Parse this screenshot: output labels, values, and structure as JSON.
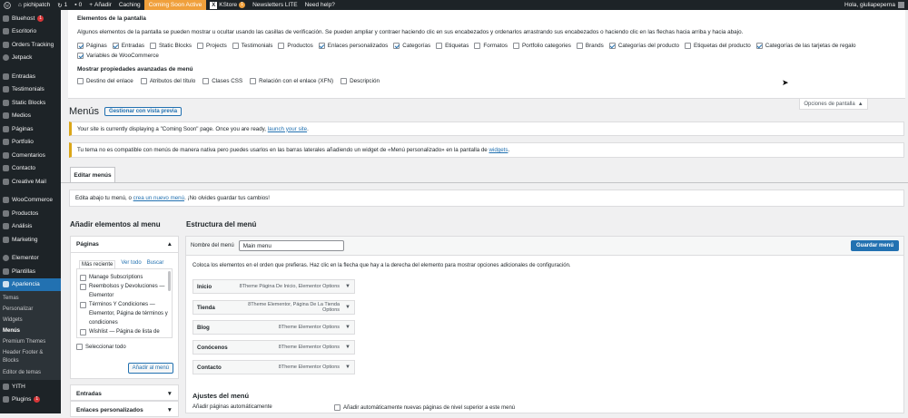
{
  "adminbar": {
    "site_name": "pichipatch",
    "updates_count": "1",
    "comments_count": "0",
    "new_label": "Añadir",
    "caching_label": "Caching",
    "coming_soon_label": "Coming Soon Active",
    "kstore_label": "KStore",
    "kstore_badge": "1",
    "newsletters_label": "Newsletters LITE",
    "help_label": "Need help?",
    "greeting": "Hola, giuliapeperna"
  },
  "sidebar": {
    "items": [
      {
        "label": "Bluehost",
        "badge": "1"
      },
      {
        "label": "Escritorio"
      },
      {
        "label": "Orders Tracking"
      },
      {
        "label": "Jetpack"
      },
      {
        "label": "Entradas"
      },
      {
        "label": "Testimonials"
      },
      {
        "label": "Static Blocks"
      },
      {
        "label": "Medios"
      },
      {
        "label": "Páginas"
      },
      {
        "label": "Portfolio"
      },
      {
        "label": "Comentarios"
      },
      {
        "label": "Contacto"
      },
      {
        "label": "Creative Mail"
      },
      {
        "label": "WooCommerce"
      },
      {
        "label": "Productos"
      },
      {
        "label": "Análisis"
      },
      {
        "label": "Marketing"
      },
      {
        "label": "Elementor"
      },
      {
        "label": "Plantillas"
      },
      {
        "label": "Apariencia"
      },
      {
        "label": "YITH"
      },
      {
        "label": "Plugins",
        "badge": "1"
      }
    ],
    "submenu": [
      "Temas",
      "Personalizar",
      "Widgets",
      "Menús",
      "Premium Themes",
      "Header Footer & Blocks",
      "Editor de temas"
    ]
  },
  "screen_options": {
    "title": "Elementos de la pantalla",
    "description": "Algunos elementos de la pantalla se pueden mostrar u ocultar usando las casillas de verificación. Se pueden ampliar y contraer haciendo clic en sus encabezados y ordenarlos arrastrando sus encabezados o haciendo clic en las flechas hacia arriba y hacia abajo.",
    "boxes": [
      {
        "label": "Páginas",
        "checked": true
      },
      {
        "label": "Entradas",
        "checked": true
      },
      {
        "label": "Static Blocks",
        "checked": false
      },
      {
        "label": "Projects",
        "checked": false
      },
      {
        "label": "Testimonials",
        "checked": false
      },
      {
        "label": "Productos",
        "checked": false
      },
      {
        "label": "Enlaces personalizados",
        "checked": true
      },
      {
        "label": "Categorías",
        "checked": true
      },
      {
        "label": "Etiquetas",
        "checked": false
      },
      {
        "label": "Formatos",
        "checked": false
      },
      {
        "label": "Portfolio categories",
        "checked": false
      },
      {
        "label": "Brands",
        "checked": false
      },
      {
        "label": "Categorías del producto",
        "checked": true
      },
      {
        "label": "Etiquetas del producto",
        "checked": false
      },
      {
        "label": "Categorías de las tarjetas de regalo",
        "checked": true
      },
      {
        "label": "Variables de WooCommerce",
        "checked": true
      }
    ],
    "advanced_title": "Mostrar propiedades avanzadas de menú",
    "advanced": [
      {
        "label": "Destino del enlace",
        "checked": false
      },
      {
        "label": "Atributos del título",
        "checked": false
      },
      {
        "label": "Clases CSS",
        "checked": false
      },
      {
        "label": "Relación con el enlace (XFN)",
        "checked": false
      },
      {
        "label": "Descripción",
        "checked": false
      }
    ],
    "tab_label": "Opciones de pantalla"
  },
  "page": {
    "title": "Menús",
    "preview_button": "Gestionar con vista previa",
    "notice1_text": "Your site is currently displaying a \"Coming Soon\" page. Once you are ready,",
    "notice1_link": "launch your site",
    "notice2_text": "Tu tema no es compatible con menús de manera nativa pero puedes usarlos en las barras laterales añadiendo un widget de «Menú personalizado» en la pantalla de",
    "notice2_link": "widgets",
    "tab_edit": "Editar menús",
    "edit_text1": "Edita abajo tu menú, o",
    "edit_link": "crea un nuevo menú",
    "edit_text2": ". ¡No olvides guardar tus cambios!"
  },
  "add_items": {
    "title": "Añadir elementos al menu",
    "pages_panel": "Páginas",
    "tabs": [
      "Más reciente",
      "Ver todo",
      "Buscar"
    ],
    "pages": [
      "Manage Subscriptions",
      "Reembolsos y Devoluciones — Elementor",
      "Términos Y Condiciones — Elementor, Página de términos y condiciones",
      "Wishlist — Página de lista de deseos"
    ],
    "select_all": "Seleccionar todo",
    "add_button": "Añadir al menú",
    "posts_panel": "Entradas",
    "custom_panel": "Enlaces personalizados"
  },
  "structure": {
    "title": "Estructura del menú",
    "name_label": "Nombre del menú",
    "name_value": "Main menu",
    "save_button": "Guardar menú",
    "instructions": "Coloca los elementos en el orden que prefieras. Haz clic en la flecha que hay a la derecha del elemento para mostrar opciones adicionales de configuración.",
    "items": [
      {
        "label": "Inicio",
        "meta": "8Theme Página De Inicio, Elementor Options"
      },
      {
        "label": "Tienda",
        "meta": "8Theme Elementor, Página De La Tienda Options"
      },
      {
        "label": "Blog",
        "meta": "8Theme Elementor Options"
      },
      {
        "label": "Conócenos",
        "meta": "8Theme Elementor Options"
      },
      {
        "label": "Contacto",
        "meta": "8Theme Elementor Options"
      }
    ],
    "settings_title": "Ajustes del menú",
    "auto_add_label": "Añadir páginas automáticamente",
    "auto_add_option": "Añadir automáticamente nuevas páginas de nivel superior a este menú"
  }
}
